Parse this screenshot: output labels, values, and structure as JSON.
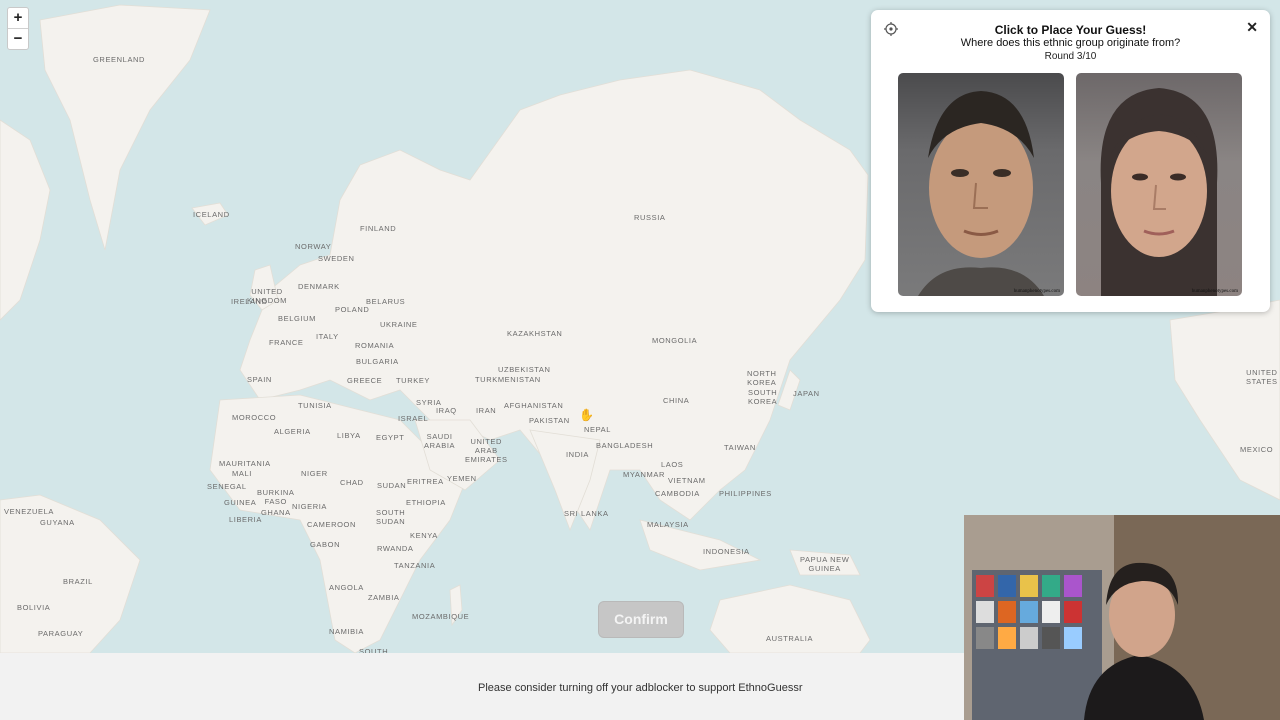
{
  "map": {
    "zoom_in": "+",
    "zoom_out": "−",
    "countries": [
      {
        "name": "GREENLAND"
      },
      {
        "name": "ICELAND"
      },
      {
        "name": "FINLAND"
      },
      {
        "name": "NORWAY"
      },
      {
        "name": "SWEDEN"
      },
      {
        "name": "RUSSIA"
      },
      {
        "name": "UNITED KINGDOM"
      },
      {
        "name": "IRELAND"
      },
      {
        "name": "DENMARK"
      },
      {
        "name": "BELARUS"
      },
      {
        "name": "POLAND"
      },
      {
        "name": "BELGIUM"
      },
      {
        "name": "UKRAINE"
      },
      {
        "name": "FRANCE"
      },
      {
        "name": "ITALY"
      },
      {
        "name": "ROMANIA"
      },
      {
        "name": "BULGARIA"
      },
      {
        "name": "SPAIN"
      },
      {
        "name": "GREECE"
      },
      {
        "name": "TURKEY"
      },
      {
        "name": "KAZAKHSTAN"
      },
      {
        "name": "MONGOLIA"
      },
      {
        "name": "UZBEKISTAN"
      },
      {
        "name": "TURKMENISTAN"
      },
      {
        "name": "SYRIA"
      },
      {
        "name": "IRAQ"
      },
      {
        "name": "IRAN"
      },
      {
        "name": "AFGHANISTAN"
      },
      {
        "name": "PAKISTAN"
      },
      {
        "name": "CHINA"
      },
      {
        "name": "NORTH KOREA"
      },
      {
        "name": "SOUTH KOREA"
      },
      {
        "name": "JAPAN"
      },
      {
        "name": "NEPAL"
      },
      {
        "name": "TUNISIA"
      },
      {
        "name": "MOROCCO"
      },
      {
        "name": "ALGERIA"
      },
      {
        "name": "LIBYA"
      },
      {
        "name": "EGYPT"
      },
      {
        "name": "ISRAEL"
      },
      {
        "name": "SAUDI ARABIA"
      },
      {
        "name": "UNITED ARAB EMIRATES"
      },
      {
        "name": "INDIA"
      },
      {
        "name": "BANGLADESH"
      },
      {
        "name": "TAIWAN"
      },
      {
        "name": "LAOS"
      },
      {
        "name": "MYANMAR"
      },
      {
        "name": "VIETNAM"
      },
      {
        "name": "CAMBODIA"
      },
      {
        "name": "PHILIPPINES"
      },
      {
        "name": "MAURITANIA"
      },
      {
        "name": "NIGER"
      },
      {
        "name": "MALI"
      },
      {
        "name": "CHAD"
      },
      {
        "name": "SUDAN"
      },
      {
        "name": "ERITREA"
      },
      {
        "name": "YEMEN"
      },
      {
        "name": "SENEGAL"
      },
      {
        "name": "BURKINA FASO"
      },
      {
        "name": "GUINEA"
      },
      {
        "name": "NIGERIA"
      },
      {
        "name": "GHANA"
      },
      {
        "name": "LIBERIA"
      },
      {
        "name": "SOUTH SUDAN"
      },
      {
        "name": "ETHIOPIA"
      },
      {
        "name": "CAMEROON"
      },
      {
        "name": "SRI LANKA"
      },
      {
        "name": "MALAYSIA"
      },
      {
        "name": "GABON"
      },
      {
        "name": "KENYA"
      },
      {
        "name": "RWANDA"
      },
      {
        "name": "TANZANIA"
      },
      {
        "name": "INDONESIA"
      },
      {
        "name": "PAPUA NEW GUINEA"
      },
      {
        "name": "ANGOLA"
      },
      {
        "name": "ZAMBIA"
      },
      {
        "name": "MOZAMBIQUE"
      },
      {
        "name": "NAMIBIA"
      },
      {
        "name": "SOUTH"
      },
      {
        "name": "AUSTRALIA"
      },
      {
        "name": "VENEZUELA"
      },
      {
        "name": "GUYANA"
      },
      {
        "name": "BRAZIL"
      },
      {
        "name": "BOLIVIA"
      },
      {
        "name": "PARAGUAY"
      },
      {
        "name": "UNITED STATES"
      },
      {
        "name": "MEXICO"
      }
    ]
  },
  "panel": {
    "title": "Click to Place Your Guess!",
    "question": "Where does this ethnic group originate from?",
    "round": "Round 3/10",
    "close": "✕",
    "watermark": "humanphenotypes.com"
  },
  "confirm_label": "Confirm",
  "footer_text": "Please consider turning off your adblocker to support EthnoGuessr",
  "colors": {
    "land": "#f4f2ee",
    "water": "#d3e6e8",
    "confirm": "#c6c6c6"
  }
}
